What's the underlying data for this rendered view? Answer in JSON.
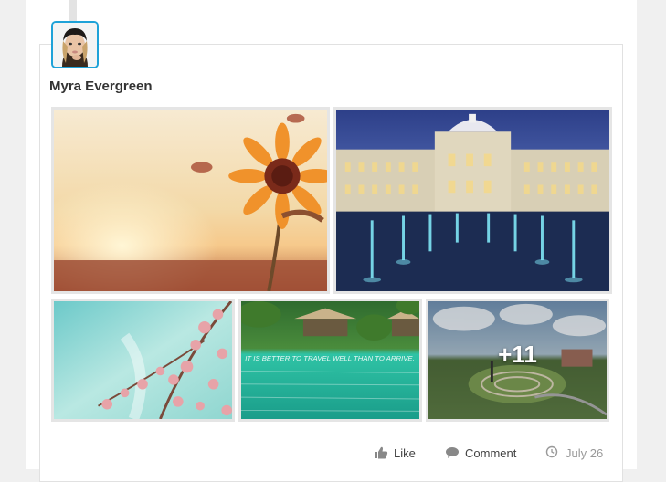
{
  "post": {
    "author": "Myra Evergreen",
    "date": "July 26",
    "photos": [
      {
        "name": "sunflower-sunset"
      },
      {
        "name": "palace-fountains"
      },
      {
        "name": "pink-blossoms"
      },
      {
        "name": "tropical-lagoon",
        "caption": "IT IS BETTER TO TRAVEL WELL THAN TO ARRIVE."
      },
      {
        "name": "hill-garden",
        "overlay": "+11"
      }
    ]
  },
  "actions": {
    "like": "Like",
    "comment": "Comment"
  },
  "icons": {
    "like": "thumbs-up-icon",
    "comment": "comment-bubble-icon",
    "date": "clock-icon"
  },
  "colors": {
    "avatar_border": "#1fa2d8",
    "icon_gray": "#888888",
    "date_gray": "#999999"
  }
}
